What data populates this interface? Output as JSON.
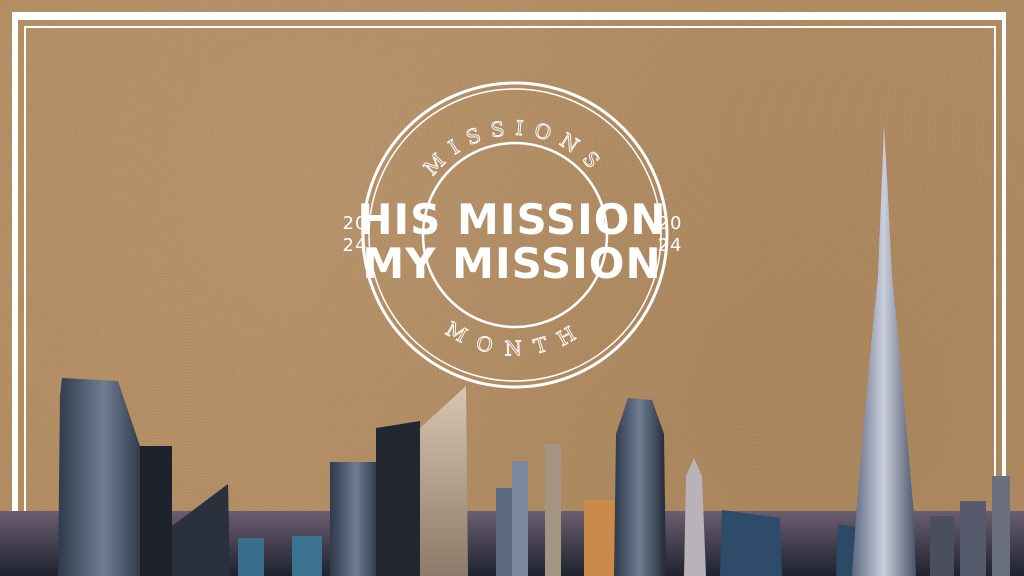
{
  "stamp": {
    "arc_top": "MISSIONS",
    "arc_bottom": "MONTH",
    "line1": "HIS MISSION",
    "line2": "MY MISSION",
    "year_left_top": "20",
    "year_left_bottom": "24",
    "year_right_top": "20",
    "year_right_bottom": "24"
  },
  "colors": {
    "background": "#b38d62",
    "frame": "#ffffff",
    "text": "#ffffff"
  }
}
